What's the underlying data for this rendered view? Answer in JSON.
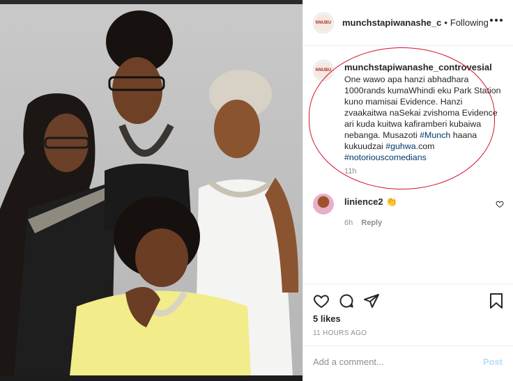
{
  "post": {
    "username": "munchstapiwanashe_c",
    "separator": "•",
    "follow_status": "Following",
    "avatar_logo": "NNUBU"
  },
  "caption": {
    "username": "munchstapiwanashe_controvesial",
    "text": "One wawo apa hanzi abhadhara 1000rands kumaWhindi eku Park Station kuno mamisai Evidence. Hanzi zvaakaitwa naSekai zvishoma Evidence ari kuda kuitwa kafiramberi kubaiwa nebanga. Musazoti ",
    "tag1": "#Munch",
    "text2": " haana kukuudzai ",
    "tag2": "#guhwa",
    "text3": ".com ",
    "tag3": "#notoriouscomedians",
    "time": "11h"
  },
  "comment": {
    "username": "linience2",
    "emoji": "👏",
    "time": "6h",
    "reply_label": "Reply"
  },
  "actions": {
    "likes": "5 likes",
    "time_ago": "11 HOURS AGO"
  },
  "add_comment": {
    "placeholder": "Add a comment...",
    "post_label": "Post"
  },
  "icons": {
    "more": "more-horizontal-icon",
    "like": "heart-icon",
    "comment": "comment-bubble-icon",
    "share": "paper-plane-icon",
    "save": "bookmark-icon"
  },
  "colors": {
    "link": "#00376b",
    "muted": "#8e8e8e",
    "post_disabled": "#b2dffc",
    "annotation_red": "#d3102a"
  }
}
